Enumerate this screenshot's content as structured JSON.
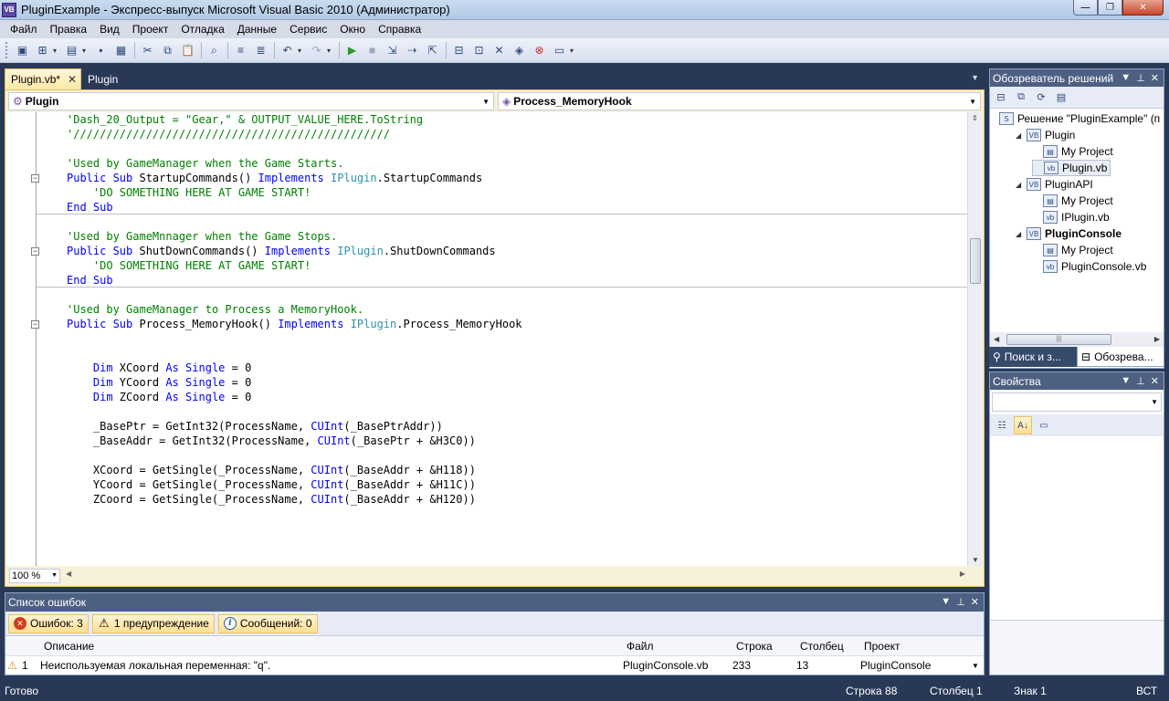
{
  "window": {
    "title": "PluginExample - Экспресс-выпуск Microsoft Visual Basic 2010 (Администратор)",
    "icon": "VB",
    "controls": {
      "minimize": "—",
      "maximize": "❐",
      "close": "✕"
    }
  },
  "menu": [
    "Файл",
    "Правка",
    "Вид",
    "Проект",
    "Отладка",
    "Данные",
    "Сервис",
    "Окно",
    "Справка"
  ],
  "toolbar": {
    "icons": [
      "new-project-icon",
      "add-item-icon",
      "open-icon",
      "save-icon",
      "save-all-icon",
      "cut-icon",
      "copy-icon",
      "paste-icon",
      "find-icon",
      "comment-icon",
      "uncomment-icon",
      "undo-icon",
      "redo-icon",
      "start-debug-icon",
      "stop-icon",
      "step-into-icon",
      "step-over-icon",
      "step-out-icon",
      "solution-explorer-icon",
      "properties-icon",
      "toolbox-icon",
      "object-browser-icon",
      "error-list-icon",
      "immediate-icon"
    ]
  },
  "doc_tabs": [
    {
      "label": "Plugin.vb*",
      "active": true
    },
    {
      "label": "Plugin",
      "active": false
    }
  ],
  "editor": {
    "class_combo": "Plugin",
    "method_combo": "Process_MemoryHook",
    "zoom": "100 %",
    "code_lines": [
      {
        "row": 0,
        "indent": 0,
        "parts": [
          {
            "t": "'Dash_20_Output = \"Gear,\" & OUTPUT_VALUE_HERE.ToString",
            "c": "cm"
          }
        ]
      },
      {
        "row": 1,
        "indent": 0,
        "parts": [
          {
            "t": "'////////////////////////////////////////////////",
            "c": "cm"
          }
        ]
      },
      {
        "row": 3,
        "indent": 0,
        "parts": [
          {
            "t": "'Used by GameManager when the Game Starts.",
            "c": "cm"
          }
        ]
      },
      {
        "row": 4,
        "indent": 0,
        "fold": true,
        "parts": [
          {
            "t": "Public Sub",
            "c": "kw"
          },
          {
            "t": " StartupCommands() ",
            "c": ""
          },
          {
            "t": "Implements",
            "c": "kw"
          },
          {
            "t": " ",
            "c": ""
          },
          {
            "t": "IPlugin",
            "c": "ty"
          },
          {
            "t": ".StartupCommands",
            "c": ""
          }
        ]
      },
      {
        "row": 5,
        "indent": 4,
        "parts": [
          {
            "t": "'DO SOMETHING HERE AT GAME START!",
            "c": "cm"
          }
        ]
      },
      {
        "row": 6,
        "indent": 0,
        "parts": [
          {
            "t": "End Sub",
            "c": "kw"
          }
        ]
      },
      {
        "row": 8,
        "indent": 0,
        "parts": [
          {
            "t": "'Used by GameMnnager when the Game Stops.",
            "c": "cm"
          }
        ]
      },
      {
        "row": 9,
        "indent": 0,
        "fold": true,
        "parts": [
          {
            "t": "Public Sub",
            "c": "kw"
          },
          {
            "t": " ShutDownCommands() ",
            "c": ""
          },
          {
            "t": "Implements",
            "c": "kw"
          },
          {
            "t": " ",
            "c": ""
          },
          {
            "t": "IPlugin",
            "c": "ty"
          },
          {
            "t": ".ShutDownCommands",
            "c": ""
          }
        ]
      },
      {
        "row": 10,
        "indent": 4,
        "parts": [
          {
            "t": "'DO SOMETHING HERE AT GAME START!",
            "c": "cm"
          }
        ]
      },
      {
        "row": 11,
        "indent": 0,
        "parts": [
          {
            "t": "End Sub",
            "c": "kw"
          }
        ]
      },
      {
        "row": 13,
        "indent": 0,
        "parts": [
          {
            "t": "'Used by GameManager to Process a MemoryHook.",
            "c": "cm"
          }
        ]
      },
      {
        "row": 14,
        "indent": 0,
        "fold": true,
        "parts": [
          {
            "t": "Public Sub",
            "c": "kw"
          },
          {
            "t": " Process_MemoryHook() ",
            "c": ""
          },
          {
            "t": "Implements",
            "c": "kw"
          },
          {
            "t": " ",
            "c": ""
          },
          {
            "t": "IPlugin",
            "c": "ty"
          },
          {
            "t": ".Process_MemoryHook",
            "c": ""
          }
        ]
      },
      {
        "row": 17,
        "indent": 4,
        "parts": [
          {
            "t": "Dim",
            "c": "kw"
          },
          {
            "t": " XCoord ",
            "c": ""
          },
          {
            "t": "As",
            "c": "kw"
          },
          {
            "t": " ",
            "c": ""
          },
          {
            "t": "Single",
            "c": "kw"
          },
          {
            "t": " = 0",
            "c": ""
          }
        ]
      },
      {
        "row": 18,
        "indent": 4,
        "parts": [
          {
            "t": "Dim",
            "c": "kw"
          },
          {
            "t": " YCoord ",
            "c": ""
          },
          {
            "t": "As",
            "c": "kw"
          },
          {
            "t": " ",
            "c": ""
          },
          {
            "t": "Single",
            "c": "kw"
          },
          {
            "t": " = 0",
            "c": ""
          }
        ]
      },
      {
        "row": 19,
        "indent": 4,
        "parts": [
          {
            "t": "Dim",
            "c": "kw"
          },
          {
            "t": " ZCoord ",
            "c": ""
          },
          {
            "t": "As",
            "c": "kw"
          },
          {
            "t": " ",
            "c": ""
          },
          {
            "t": "Single",
            "c": "kw"
          },
          {
            "t": " = 0",
            "c": ""
          }
        ]
      },
      {
        "row": 21,
        "indent": 4,
        "parts": [
          {
            "t": "_BasePtr = GetInt32(ProcessName, ",
            "c": ""
          },
          {
            "t": "CUInt",
            "c": "kw"
          },
          {
            "t": "(_BasePtrAddr))",
            "c": ""
          }
        ]
      },
      {
        "row": 22,
        "indent": 4,
        "parts": [
          {
            "t": "_BaseAddr = GetInt32(ProcessName, ",
            "c": ""
          },
          {
            "t": "CUInt",
            "c": "kw"
          },
          {
            "t": "(_BasePtr + &H3C0))",
            "c": ""
          }
        ]
      },
      {
        "row": 24,
        "indent": 4,
        "parts": [
          {
            "t": "XCoord = GetSingle(_ProcessName, ",
            "c": ""
          },
          {
            "t": "CUInt",
            "c": "kw"
          },
          {
            "t": "(_BaseAddr + &H118))",
            "c": ""
          }
        ]
      },
      {
        "row": 25,
        "indent": 4,
        "parts": [
          {
            "t": "YCoord = GetSingle(_ProcessName, ",
            "c": ""
          },
          {
            "t": "CUInt",
            "c": "kw"
          },
          {
            "t": "(_BaseAddr + &H11C))",
            "c": ""
          }
        ]
      },
      {
        "row": 26,
        "indent": 4,
        "parts": [
          {
            "t": "ZCoord = GetSingle(_ProcessName, ",
            "c": ""
          },
          {
            "t": "CUInt",
            "c": "kw"
          },
          {
            "t": "(_BaseAddr + &H120))",
            "c": ""
          }
        ]
      }
    ]
  },
  "error_list": {
    "title": "Список ошибок",
    "filters": {
      "errors": "Ошибок: 3",
      "warnings": "1 предупреждение",
      "messages": "Сообщений: 0"
    },
    "columns": {
      "description": "Описание",
      "file": "Файл",
      "line": "Строка",
      "column": "Столбец",
      "project": "Проект"
    },
    "rows": [
      {
        "num": "1",
        "description": "Неиспользуемая локальная переменная: \"q\".",
        "file": "PluginConsole.vb",
        "line": "233",
        "column": "13",
        "project": "PluginConsole"
      }
    ]
  },
  "solution_explorer": {
    "title": "Обозреватель решений",
    "items": [
      {
        "label": "Решение \"PluginExample\" (п",
        "level": 0,
        "icon": "solution-icon",
        "expand": ""
      },
      {
        "label": "Plugin",
        "level": 1,
        "icon": "vb-project-icon",
        "expand": "◢"
      },
      {
        "label": "My Project",
        "level": 2,
        "icon": "my-project-icon",
        "expand": ""
      },
      {
        "label": "Plugin.vb",
        "level": 2,
        "icon": "vb-file-icon",
        "expand": "",
        "selected": true
      },
      {
        "label": "PluginAPI",
        "level": 1,
        "icon": "vb-project-icon",
        "expand": "◢"
      },
      {
        "label": "My Project",
        "level": 2,
        "icon": "my-project-icon",
        "expand": ""
      },
      {
        "label": "IPlugin.vb",
        "level": 2,
        "icon": "vb-file-icon",
        "expand": ""
      },
      {
        "label": "PluginConsole",
        "level": 1,
        "icon": "vb-project-icon",
        "expand": "◢",
        "bold": true
      },
      {
        "label": "My Project",
        "level": 2,
        "icon": "my-project-icon",
        "expand": ""
      },
      {
        "label": "PluginConsole.vb",
        "level": 2,
        "icon": "vb-file-icon",
        "expand": ""
      }
    ]
  },
  "side_tabs": [
    {
      "label": "Поиск и з...",
      "active": false
    },
    {
      "label": "Обозрева...",
      "active": true
    }
  ],
  "properties": {
    "title": "Свойства"
  },
  "statusbar": {
    "status": "Готово",
    "row": "Строка 88",
    "col": "Столбец 1",
    "char": "Знак 1",
    "mode": "ВСТ"
  }
}
